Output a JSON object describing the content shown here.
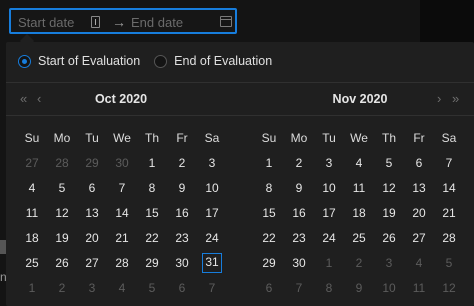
{
  "range_input": {
    "start_placeholder": "Start date",
    "separator": "→",
    "end_placeholder": "End date"
  },
  "radio_options": [
    {
      "label": "Start of Evaluation",
      "checked": true
    },
    {
      "label": "End of Evaluation",
      "checked": false
    }
  ],
  "weekdays": [
    "Su",
    "Mo",
    "Tu",
    "We",
    "Th",
    "Fr",
    "Sa"
  ],
  "nav": {
    "super_prev": "«",
    "prev": "‹",
    "next": "›",
    "super_next": "»"
  },
  "calendars": [
    {
      "title": "Oct  2020",
      "weeks": [
        [
          {
            "d": "27",
            "out": true
          },
          {
            "d": "28",
            "out": true
          },
          {
            "d": "29",
            "out": true
          },
          {
            "d": "30",
            "out": true
          },
          {
            "d": "1"
          },
          {
            "d": "2"
          },
          {
            "d": "3"
          }
        ],
        [
          {
            "d": "4"
          },
          {
            "d": "5"
          },
          {
            "d": "6"
          },
          {
            "d": "7"
          },
          {
            "d": "8"
          },
          {
            "d": "9"
          },
          {
            "d": "10"
          }
        ],
        [
          {
            "d": "11"
          },
          {
            "d": "12"
          },
          {
            "d": "13"
          },
          {
            "d": "14"
          },
          {
            "d": "15"
          },
          {
            "d": "16"
          },
          {
            "d": "17"
          }
        ],
        [
          {
            "d": "18"
          },
          {
            "d": "19"
          },
          {
            "d": "20"
          },
          {
            "d": "21"
          },
          {
            "d": "22"
          },
          {
            "d": "23"
          },
          {
            "d": "24"
          }
        ],
        [
          {
            "d": "25"
          },
          {
            "d": "26"
          },
          {
            "d": "27"
          },
          {
            "d": "28"
          },
          {
            "d": "29"
          },
          {
            "d": "30"
          },
          {
            "d": "31",
            "today": true
          }
        ],
        [
          {
            "d": "1",
            "out": true
          },
          {
            "d": "2",
            "out": true
          },
          {
            "d": "3",
            "out": true
          },
          {
            "d": "4",
            "out": true
          },
          {
            "d": "5",
            "out": true
          },
          {
            "d": "6",
            "out": true
          },
          {
            "d": "7",
            "out": true
          }
        ]
      ]
    },
    {
      "title": "Nov  2020",
      "weeks": [
        [
          {
            "d": "1"
          },
          {
            "d": "2"
          },
          {
            "d": "3"
          },
          {
            "d": "4"
          },
          {
            "d": "5"
          },
          {
            "d": "6"
          },
          {
            "d": "7"
          }
        ],
        [
          {
            "d": "8"
          },
          {
            "d": "9"
          },
          {
            "d": "10"
          },
          {
            "d": "11"
          },
          {
            "d": "12"
          },
          {
            "d": "13"
          },
          {
            "d": "14"
          }
        ],
        [
          {
            "d": "15"
          },
          {
            "d": "16"
          },
          {
            "d": "17"
          },
          {
            "d": "18"
          },
          {
            "d": "19"
          },
          {
            "d": "20"
          },
          {
            "d": "21"
          }
        ],
        [
          {
            "d": "22"
          },
          {
            "d": "23"
          },
          {
            "d": "24"
          },
          {
            "d": "25"
          },
          {
            "d": "26"
          },
          {
            "d": "27"
          },
          {
            "d": "28"
          }
        ],
        [
          {
            "d": "29"
          },
          {
            "d": "30"
          },
          {
            "d": "1",
            "out": true
          },
          {
            "d": "2",
            "out": true
          },
          {
            "d": "3",
            "out": true
          },
          {
            "d": "4",
            "out": true
          },
          {
            "d": "5",
            "out": true
          }
        ],
        [
          {
            "d": "6",
            "out": true
          },
          {
            "d": "7",
            "out": true
          },
          {
            "d": "8",
            "out": true
          },
          {
            "d": "9",
            "out": true
          },
          {
            "d": "10",
            "out": true
          },
          {
            "d": "11",
            "out": true
          },
          {
            "d": "12",
            "out": true
          }
        ]
      ]
    }
  ],
  "background": {
    "edge_text": "n"
  },
  "colors": {
    "accent": "#177ddc",
    "panel": "#1f1f1f",
    "muted_text": "#5c5c5c"
  }
}
